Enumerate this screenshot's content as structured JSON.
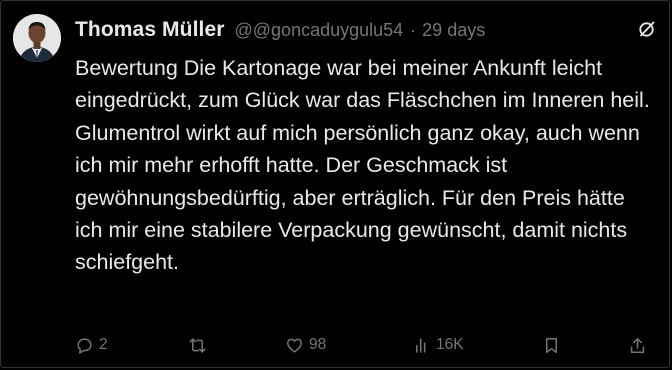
{
  "post": {
    "author_name": "Thomas Müller",
    "handle": "@@goncaduygulu54",
    "separator": "·",
    "time": "29 days",
    "text": "Bewertung Die Kartonage war bei meiner Ankunft leicht eingedrückt, zum Glück war das Fläschchen im Inneren heil. Glumentrol wirkt auf mich persönlich ganz okay, auch wenn ich mir mehr erhofft hatte. Der Geschmack ist gewöhnungsbedürftig, aber erträglich. Für den Preis hätte ich mir eine stabilere Verpackung gewünscht, damit nichts schiefgeht."
  },
  "actions": {
    "replies": "2",
    "reposts": "",
    "likes": "98",
    "views": "16K"
  },
  "icons": {
    "reply": "reply-bubble-icon",
    "repost": "repost-arrows-icon",
    "like": "heart-icon",
    "views": "views-bar-chart-icon",
    "bookmark": "bookmark-icon",
    "share": "share-upload-icon",
    "grok": "grok-slash-circle-icon"
  },
  "colors": {
    "background": "#000000",
    "text_primary": "#e7e9ea",
    "text_secondary": "#71767b",
    "border": "#2f3336"
  }
}
